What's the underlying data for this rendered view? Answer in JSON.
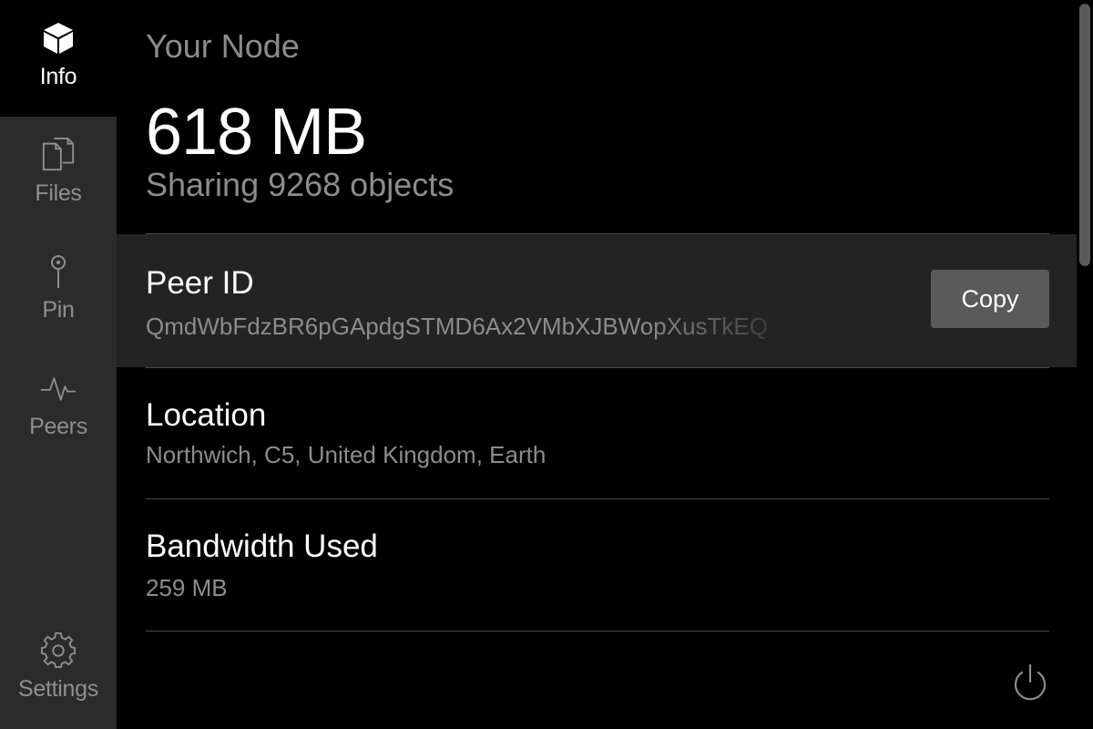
{
  "sidebar": {
    "items": [
      {
        "label": "Info",
        "icon": "cube-icon",
        "active": true
      },
      {
        "label": "Files",
        "icon": "files-icon",
        "active": false
      },
      {
        "label": "Pin",
        "icon": "pin-icon",
        "active": false
      },
      {
        "label": "Peers",
        "icon": "pulse-icon",
        "active": false
      },
      {
        "label": "Settings",
        "icon": "gear-icon",
        "active": false
      }
    ]
  },
  "main": {
    "title": "Your Node",
    "repo_size": "618 MB",
    "sharing": "Sharing 9268 objects",
    "peer_id": {
      "label": "Peer ID",
      "value": "QmdWbFdzBR6pGApdgSTMD6Ax2VMbXJBWopXusTkEQ",
      "copy_label": "Copy"
    },
    "location": {
      "label": "Location",
      "value": "Northwich, C5, United Kingdom, Earth"
    },
    "bandwidth": {
      "label": "Bandwidth Used",
      "value": "259 MB"
    },
    "power_icon": "power-icon"
  },
  "colors": {
    "sidebar_bg": "#2b2b2b",
    "active_bg": "#000000",
    "muted_text": "#8c8c8c",
    "highlight_row": "#232323",
    "button_bg": "#5a5a5a"
  }
}
